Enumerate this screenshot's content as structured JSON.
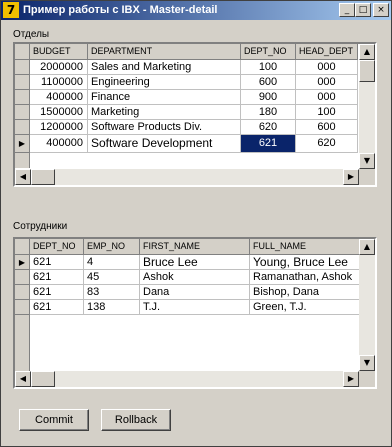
{
  "window": {
    "title": "Пример работы с IBX - Master-detail",
    "icon": "delphi-app-icon",
    "buttons": {
      "minimize": "_",
      "maximize": "□",
      "close": "×"
    }
  },
  "master": {
    "label": "Отделы",
    "columns": [
      "BUDGET",
      "DEPARTMENT",
      "DEPT_NO",
      "HEAD_DEPT"
    ],
    "rows": [
      {
        "budget": "2000000",
        "department": "Sales and Marketing",
        "dept_no": "100",
        "head_dept": "000"
      },
      {
        "budget": "1100000",
        "department": "Engineering",
        "dept_no": "600",
        "head_dept": "000"
      },
      {
        "budget": "400000",
        "department": "Finance",
        "dept_no": "900",
        "head_dept": "000"
      },
      {
        "budget": "1500000",
        "department": "Marketing",
        "dept_no": "180",
        "head_dept": "100"
      },
      {
        "budget": "1200000",
        "department": "Software Products Div.",
        "dept_no": "620",
        "head_dept": "600"
      },
      {
        "budget": "400000",
        "department": "Software Development",
        "dept_no": "621",
        "head_dept": "620"
      }
    ],
    "current_row_indicator": "▶",
    "selected_row": 5
  },
  "detail": {
    "label": "Сотрудники",
    "columns": [
      "DEPT_NO",
      "EMP_NO",
      "FIRST_NAME",
      "FULL_NAME"
    ],
    "rows": [
      {
        "dept_no": "621",
        "emp_no": "4",
        "first_name": "Bruce Lee",
        "full_name": "Young, Bruce Lee"
      },
      {
        "dept_no": "621",
        "emp_no": "45",
        "first_name": "Ashok",
        "full_name": "Ramanathan, Ashok"
      },
      {
        "dept_no": "621",
        "emp_no": "83",
        "first_name": "Dana",
        "full_name": "Bishop, Dana"
      },
      {
        "dept_no": "621",
        "emp_no": "138",
        "first_name": "T.J.",
        "full_name": "Green, T.J."
      }
    ],
    "current_row_indicator": "▶"
  },
  "scroll": {
    "up": "▲",
    "down": "▼",
    "left": "◀",
    "right": "▶"
  },
  "actions": {
    "commit": "Commit",
    "rollback": "Rollback"
  }
}
